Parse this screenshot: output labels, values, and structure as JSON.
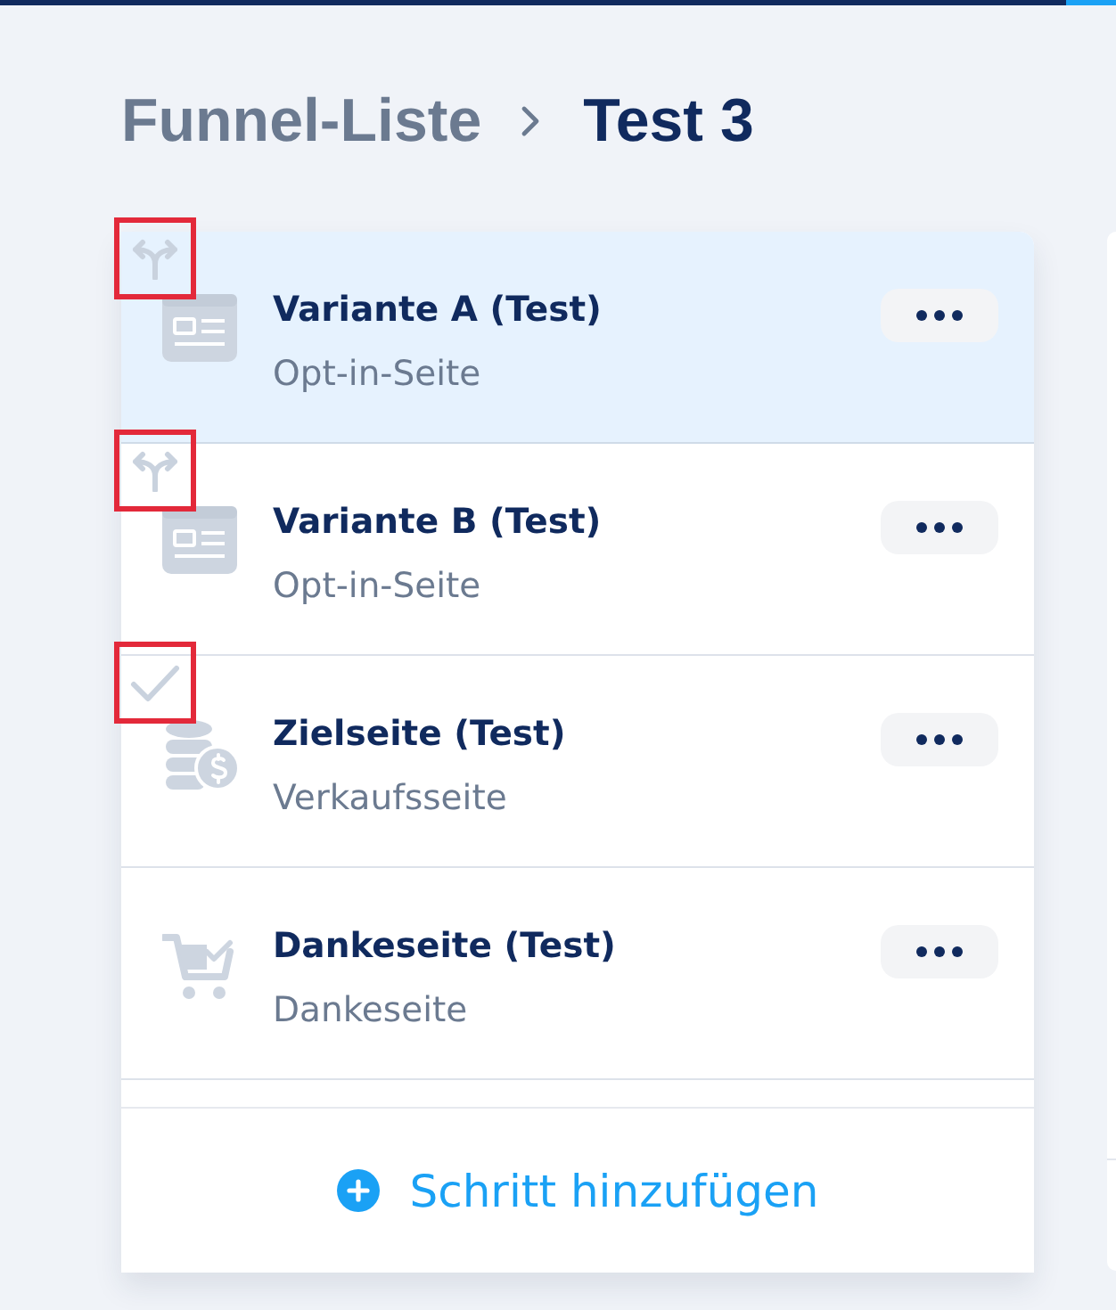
{
  "breadcrumb": {
    "parent": "Funnel-Liste",
    "current": "Test 3"
  },
  "steps": [
    {
      "title": "Variante A (Test)",
      "subtitle": "Opt-in-Seite",
      "kind": "optin",
      "selected": true,
      "marker": {
        "kind": "split",
        "highlighted": true
      }
    },
    {
      "title": "Variante B (Test)",
      "subtitle": "Opt-in-Seite",
      "kind": "optin",
      "selected": false,
      "marker": {
        "kind": "split",
        "highlighted": true
      }
    },
    {
      "title": "Zielseite (Test)",
      "subtitle": "Verkaufsseite",
      "kind": "sales",
      "selected": false,
      "marker": {
        "kind": "check",
        "highlighted": true
      }
    },
    {
      "title": "Dankeseite (Test)",
      "subtitle": "Dankeseite",
      "kind": "thanks",
      "selected": false
    }
  ],
  "add_button": {
    "label": "Schritt hinzufügen"
  }
}
